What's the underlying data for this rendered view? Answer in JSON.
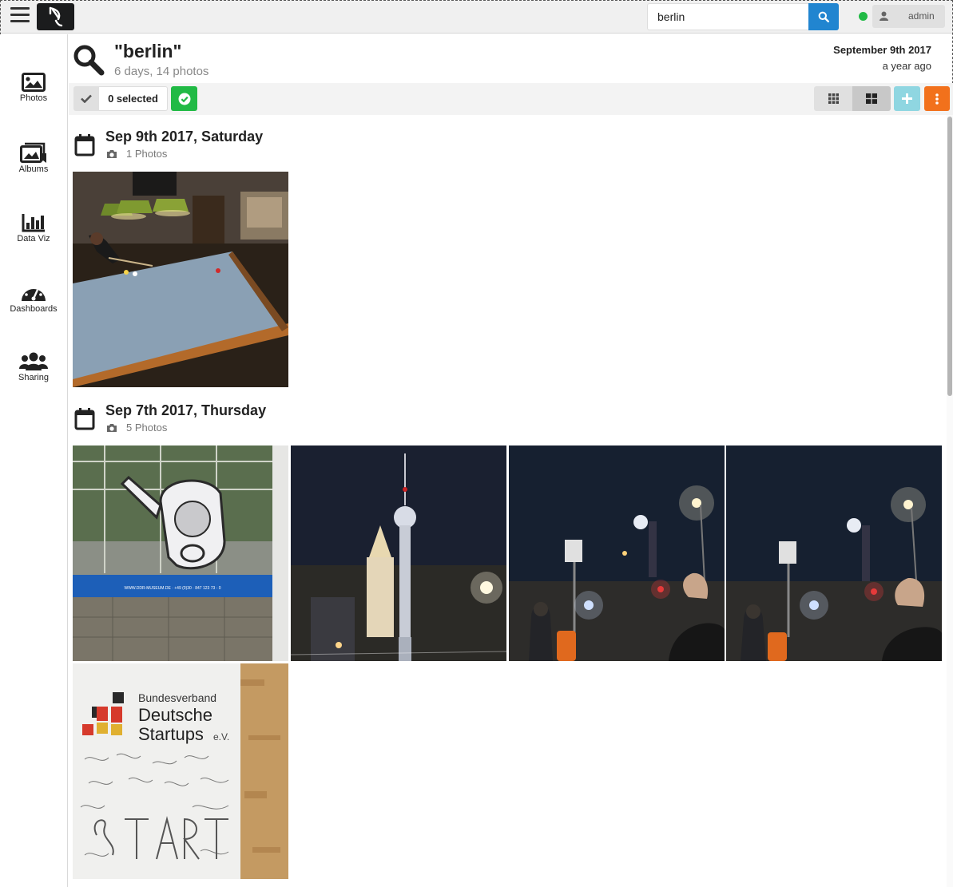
{
  "topbar": {
    "search_value": "berlin",
    "user_label": "admin",
    "status_color": "#21ba45",
    "search_button_color": "#2185d0"
  },
  "sidebar": {
    "items": [
      {
        "label": "Photos",
        "icon": "photo-icon"
      },
      {
        "label": "Albums",
        "icon": "albums-icon"
      },
      {
        "label": "Data Viz",
        "icon": "bar-chart-icon"
      },
      {
        "label": "Dashboards",
        "icon": "dashboard-icon"
      },
      {
        "label": "Sharing",
        "icon": "users-icon"
      }
    ]
  },
  "header": {
    "title": "\"berlin\"",
    "subtitle": "6 days, 14 photos",
    "date": "September 9th 2017",
    "relative": "a year ago"
  },
  "toolbar": {
    "selected_label": "0 selected",
    "ok_color": "#21ba45",
    "add_color": "#8fd6e1",
    "more_color": "#f2711c"
  },
  "days": [
    {
      "title": "Sep 9th 2017, Saturday",
      "count": "1 Photos",
      "photos": [
        "billiards"
      ]
    },
    {
      "title": "Sep 7th 2017, Thursday",
      "count": "5 Photos",
      "photos": [
        "ddr-museum-window",
        "tv-tower-night",
        "street-night-1",
        "street-night-2",
        "startup-board"
      ]
    }
  ],
  "startup_board": {
    "line1": "Bundesverband",
    "line2": "Deutsche",
    "line3": "Startups",
    "suffix": "e.V."
  },
  "ddr_museum_banner": "WWW.DDR-MUSEUM.DE · +49 (0)30 · 847 123 73 - 0"
}
